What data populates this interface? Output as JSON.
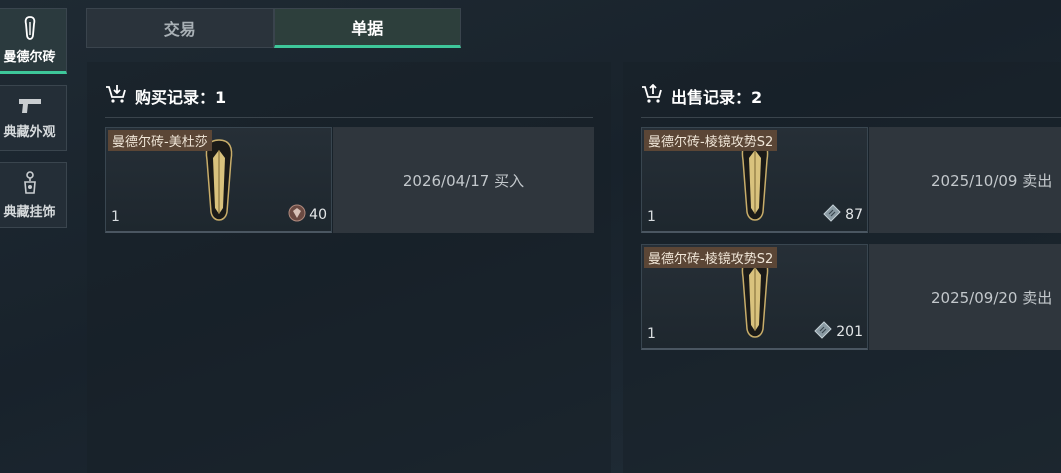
{
  "categories": [
    {
      "label": "曼德尔砖",
      "icon": "mandel-brick-icon",
      "active": true
    },
    {
      "label": "典藏外观",
      "icon": "pistol-icon",
      "active": false
    },
    {
      "label": "典藏挂饰",
      "icon": "charm-icon",
      "active": false
    }
  ],
  "tabs": [
    {
      "label": "交易",
      "active": false
    },
    {
      "label": "单据",
      "active": true
    }
  ],
  "buy_panel": {
    "title": "购买记录：1",
    "records": [
      {
        "name": "曼德尔砖-美杜莎",
        "qty": "1",
        "price": "40",
        "currency_icon": "coin-icon",
        "info": "2026/04/17 买入"
      }
    ]
  },
  "sell_panel": {
    "title": "出售记录：2",
    "records": [
      {
        "name": "曼德尔砖-棱镜攻势S2",
        "qty": "1",
        "price": "87",
        "currency_icon": "ticket-icon",
        "info": "2025/10/09 卖出"
      },
      {
        "name": "曼德尔砖-棱镜攻势S2",
        "qty": "1",
        "price": "201",
        "currency_icon": "ticket-icon",
        "info": "2025/09/20 卖出"
      }
    ]
  },
  "colors": {
    "accent": "#3ec79a",
    "name_tag": "#5b4636"
  }
}
